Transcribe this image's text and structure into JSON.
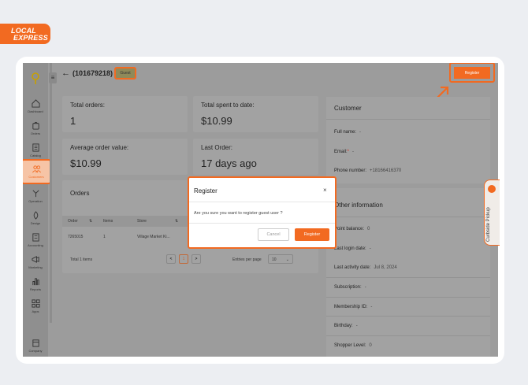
{
  "brand": {
    "line1": "LOCAL",
    "line2": "EXPRESS",
    "accent": "#f26a21"
  },
  "header": {
    "order_id": "(101679218)",
    "badge": "Guest",
    "register_label": "Register"
  },
  "sidebar": {
    "items": [
      {
        "label": "Dashboard",
        "icon": "home-icon"
      },
      {
        "label": "Orders",
        "icon": "bag-icon"
      },
      {
        "label": "Catalog",
        "icon": "catalog-icon"
      },
      {
        "label": "Customers",
        "icon": "users-icon"
      },
      {
        "label": "Operation",
        "icon": "operation-icon"
      },
      {
        "label": "Design",
        "icon": "design-icon"
      },
      {
        "label": "Accounting",
        "icon": "accounting-icon"
      },
      {
        "label": "Marketing",
        "icon": "megaphone-icon"
      },
      {
        "label": "Reports",
        "icon": "chart-icon"
      },
      {
        "label": "Apps",
        "icon": "apps-icon"
      },
      {
        "label": "Company",
        "icon": "company-icon"
      }
    ]
  },
  "stats": {
    "total_orders": {
      "label": "Total orders:",
      "value": "1"
    },
    "total_spent": {
      "label": "Total spent to date:",
      "value": "$10.99"
    },
    "avg_order": {
      "label": "Average order value:",
      "value": "$10.99"
    },
    "last_order": {
      "label": "Last Order:",
      "value": "17 days ago"
    }
  },
  "orders": {
    "title": "Orders",
    "columns": [
      "Order",
      "Items",
      "Store"
    ],
    "rows": [
      {
        "order": "7265015",
        "items": "1",
        "store": "Village Market Ki..."
      }
    ],
    "total": "Total 1 items",
    "page": "1",
    "prev": "<",
    "next": ">",
    "entries_label": "Entries per page",
    "entries_value": "10"
  },
  "customer": {
    "title": "Customer",
    "full_name": {
      "label": "Full name:",
      "value": "-"
    },
    "email": {
      "label": "Email:",
      "required": "*",
      "value": "-"
    },
    "phone": {
      "label": "Phone number:",
      "value": "+18166416370"
    },
    "other_title": "Other information",
    "point_balance": {
      "label": "Point balance:",
      "value": "0"
    },
    "last_login": {
      "label": "Last login date:",
      "value": "-"
    },
    "last_activity": {
      "label": "Last activity date:",
      "value": "Jul 8, 2024"
    },
    "subscription": {
      "label": "Subscription:",
      "value": "-"
    },
    "membership": {
      "label": "Membership ID:",
      "value": "-"
    },
    "birthday": {
      "label": "Birthday:",
      "value": "-"
    },
    "shopper_level": {
      "label": "Shopper Level:",
      "value": "0"
    }
  },
  "curbside": {
    "label": "Curbside Pickup"
  },
  "dialog": {
    "title": "Register",
    "close": "×",
    "message": "Are you sure you want to register guest user ?",
    "cancel": "Cancel",
    "confirm": "Register"
  }
}
